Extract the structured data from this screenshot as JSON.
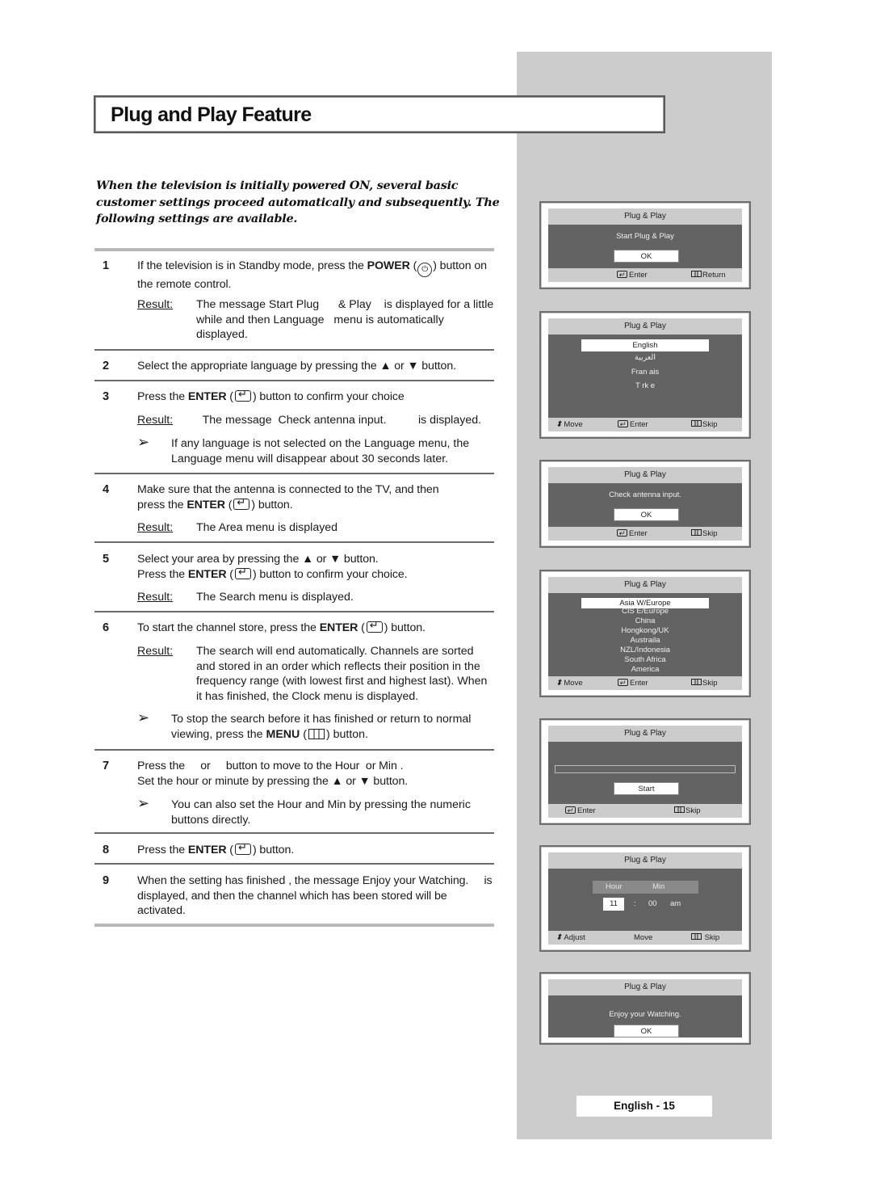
{
  "page": {
    "title": "Plug and Play Feature",
    "intro": "When the television is initially powered ON, several basic customer settings proceed automatically and subsequently. The following settings are available.",
    "footer": "English - 15"
  },
  "labels": {
    "result": "Result:",
    "note_arrow": "➢",
    "power": "POWER",
    "enter": "ENTER",
    "menu": "MENU"
  },
  "steps": [
    {
      "num": "1",
      "pre": "If the television is in Standby mode, press the ",
      "post": ") button on the remote control.",
      "result": "The message Start Plug      & Play    is displayed for a little while and then Language   menu is automatically displayed."
    },
    {
      "num": "2",
      "text": "Select the appropriate language by pressing the ▲ or ▼ button."
    },
    {
      "num": "3",
      "pre": "Press the ",
      "post": ") button to confirm your choice",
      "result": "  The message  Check antenna input.          is displayed.",
      "note": "If any language is not selected on the Language   menu, the Language   menu will disappear about 30 seconds later."
    },
    {
      "num": "4",
      "line1": "Make sure that the antenna is connected to the TV, and then",
      "pre": "press the ",
      "post": ") button.",
      "result": "The  Area  menu is displayed"
    },
    {
      "num": "5",
      "line1": "Select your area by pressing the ▲ or ▼ button.",
      "pre": "Press the ",
      "post": ") button to confirm your choice.",
      "result": "The  Search   menu is displayed."
    },
    {
      "num": "6",
      "pre": "To start the channel store, press the ",
      "post": ") button.",
      "result": "The search will end automatically. Channels are sorted and stored in an order which reflects their position in the frequency range (with lowest first and highest last). When it has finished, the Clock   menu is displayed.",
      "note_pre": "To stop the search before it has finished or return to normal viewing, press the ",
      "note_post": ") button."
    },
    {
      "num": "7",
      "line1": "Press the     or     button to move to the Hour  or Min .",
      "line2": "Set the hour or minute by pressing the ▲ or ▼ button.",
      "note": "You can also set the Hour  and Min  by pressing the numeric buttons directly."
    },
    {
      "num": "8",
      "pre": "Press the ",
      "post": ") button."
    },
    {
      "num": "9",
      "text": "When the setting has finished , the message Enjoy your Watching.     is displayed, and then the channel which has been stored will be activated."
    }
  ],
  "screens": {
    "osd_title": "Plug & Play",
    "s1": {
      "message": "Start Plug & Play",
      "button": "OK",
      "foot_enter": "Enter",
      "foot_right": "Return"
    },
    "s2": {
      "selected": "English",
      "items": [
        "العربية",
        "Fran ais",
        "T rk e"
      ],
      "foot_move": "Move",
      "foot_enter": "Enter",
      "foot_right": "Skip"
    },
    "s3": {
      "message": "Check antenna input.",
      "button": "OK",
      "foot_enter": "Enter",
      "foot_right": "Skip"
    },
    "s4": {
      "selected": "Asia W/Europe",
      "items": [
        "CIS E/Europe",
        "China",
        "Hongkong/UK",
        "Austraila",
        "NZL/Indonesia",
        "South Africa",
        "America"
      ],
      "foot_move": "Move",
      "foot_enter": "Enter",
      "foot_right": "Skip"
    },
    "s5": {
      "progress": 0,
      "button": "Start",
      "foot_enter": "Enter",
      "foot_right": "Skip"
    },
    "s6": {
      "hour_label": "Hour",
      "min_label": "Min",
      "hour": "11",
      "sep": ":",
      "min": "00",
      "ampm": "am",
      "foot_adjust": "Adjust",
      "foot_move": "Move",
      "foot_right": "Skip"
    },
    "s7": {
      "message": "Enjoy your Watching.",
      "button": "OK"
    }
  }
}
